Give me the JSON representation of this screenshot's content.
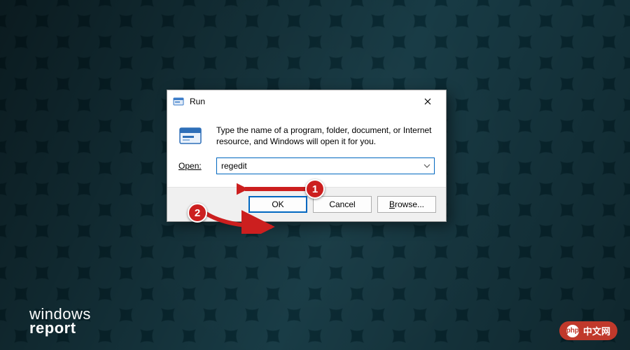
{
  "dialog": {
    "title": "Run",
    "description": "Type the name of a program, folder, document, or Internet resource, and Windows will open it for you.",
    "open_label_full": "Open:",
    "open_label_u": "O",
    "open_label_rest": "pen:",
    "input_value": "regedit",
    "buttons": {
      "ok": "OK",
      "cancel": "Cancel",
      "browse_u": "B",
      "browse_rest": "rowse..."
    }
  },
  "annotations": {
    "step1": "1",
    "step2": "2"
  },
  "watermarks": {
    "left_line1": "windows",
    "left_line2": "report",
    "right_prefix": "php",
    "right_text": "中文网"
  },
  "colors": {
    "accent": "#0067c0",
    "annotation": "#cc1f1f"
  }
}
